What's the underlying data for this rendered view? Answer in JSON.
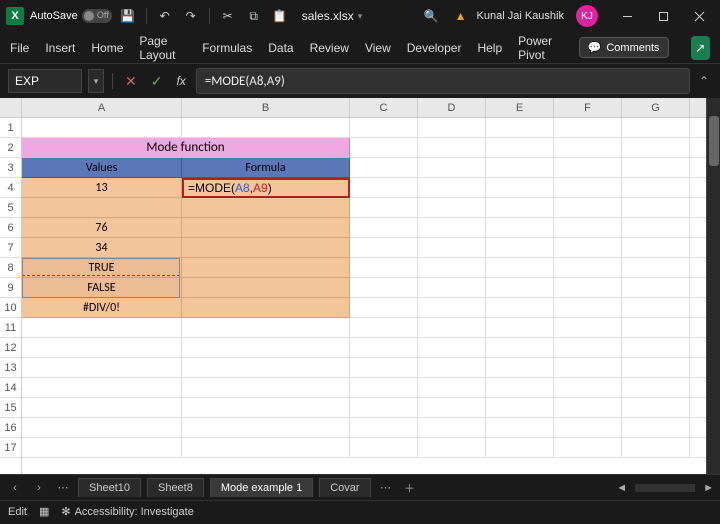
{
  "title": {
    "autosave": "AutoSave",
    "toggle": "Off",
    "filename": "sales.xlsx",
    "user": "Kunal Jai Kaushik",
    "initials": "KJ"
  },
  "ribbon": {
    "tabs": [
      "File",
      "Insert",
      "Home",
      "Page Layout",
      "Formulas",
      "Data",
      "Review",
      "View",
      "Developer",
      "Help",
      "Power Pivot"
    ],
    "comments": "Comments"
  },
  "fx": {
    "name": "EXP",
    "formula": "=MODE(A8,A9)",
    "prefix": "=MODE(",
    "arg1": "A8",
    "comma": ",",
    "arg2": "A9",
    "suffix": ")"
  },
  "cols": [
    "A",
    "B",
    "C",
    "D",
    "E",
    "F",
    "G"
  ],
  "rows": [
    "1",
    "2",
    "3",
    "4",
    "5",
    "6",
    "7",
    "8",
    "9",
    "10",
    "11",
    "12",
    "13",
    "14",
    "15",
    "16",
    "17"
  ],
  "sheet": {
    "title": "Mode function",
    "h1": "Values",
    "h2": "Formula",
    "v4": "13",
    "v5": "",
    "v6": "76",
    "v7": "34",
    "v8": "TRUE",
    "v9": "FALSE",
    "v10": "#DIV/0!"
  },
  "tabs": {
    "s1": "Sheet10",
    "s2": "Sheet8",
    "s3": "Mode example 1",
    "s4": "Covar"
  },
  "status": {
    "mode": "Edit",
    "acc": "Accessibility: Investigate"
  }
}
